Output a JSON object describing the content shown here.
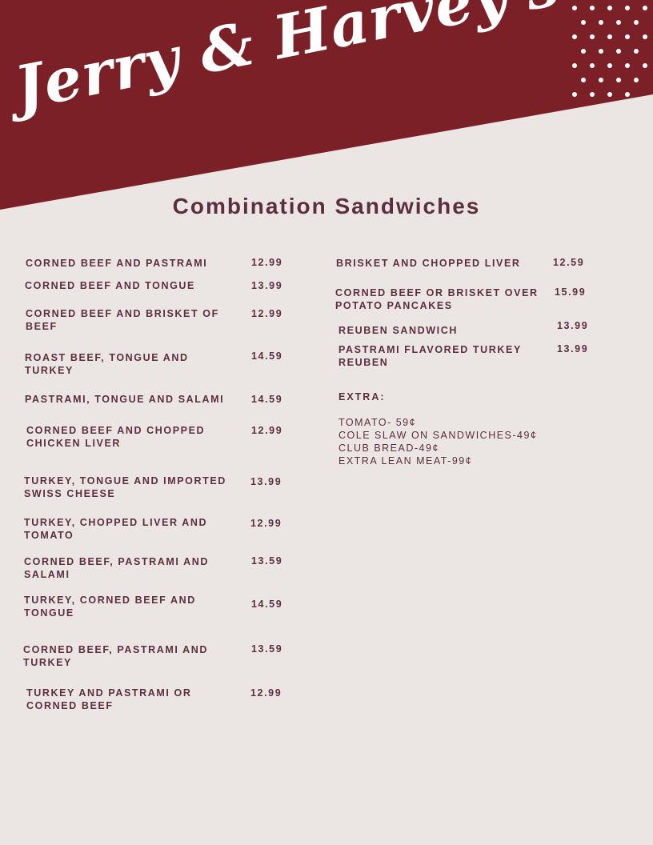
{
  "brand": "Jerry & Harvey's",
  "colors": {
    "banner": "#7b2026",
    "background": "#ebe6e4",
    "text": "#5b2e40"
  },
  "title": "Combination Sandwiches",
  "left_items": [
    {
      "name": "CORNED BEEF AND PASTRAMI",
      "price": "12.99"
    },
    {
      "name": "CORNED BEEF AND TONGUE",
      "price": "13.99"
    },
    {
      "name": "CORNED BEEF AND BRISKET OF BEEF",
      "price": "12.99"
    },
    {
      "name": "ROAST BEEF, TONGUE AND TURKEY",
      "price": "14.59"
    },
    {
      "name": "PASTRAMI, TONGUE AND SALAMI",
      "price": "14.59"
    },
    {
      "name": "CORNED BEEF AND CHOPPED CHICKEN LIVER",
      "price": "12.99"
    },
    {
      "name": "TURKEY, TONGUE AND IMPORTED SWISS CHEESE",
      "price": "13.99"
    },
    {
      "name": "TURKEY, CHOPPED LIVER AND TOMATO",
      "price": "12.99"
    },
    {
      "name": "CORNED BEEF, PASTRAMI AND SALAMI",
      "price": "13.59"
    },
    {
      "name": "TURKEY, CORNED BEEF AND TONGUE",
      "price": "14.59"
    },
    {
      "name": "CORNED BEEF, PASTRAMI AND TURKEY",
      "price": "13.59"
    },
    {
      "name": "TURKEY AND PASTRAMI OR CORNED BEEF",
      "price": "12.99"
    }
  ],
  "right_items": [
    {
      "name": "BRISKET AND CHOPPED LIVER",
      "price": "12.59"
    },
    {
      "name": "CORNED BEEF OR BRISKET OVER POTATO PANCAKES",
      "price": "15.99"
    },
    {
      "name": "REUBEN SANDWICH",
      "price": "13.99"
    },
    {
      "name": "PASTRAMI FLAVORED TURKEY REUBEN",
      "price": "13.99"
    }
  ],
  "extras": {
    "heading": "EXTRA:",
    "lines": [
      "TOMATO- 59¢",
      "COLE SLAW ON SANDWICHES-49¢",
      "CLUB BREAD-49¢",
      "EXTRA LEAN MEAT-99¢"
    ]
  }
}
